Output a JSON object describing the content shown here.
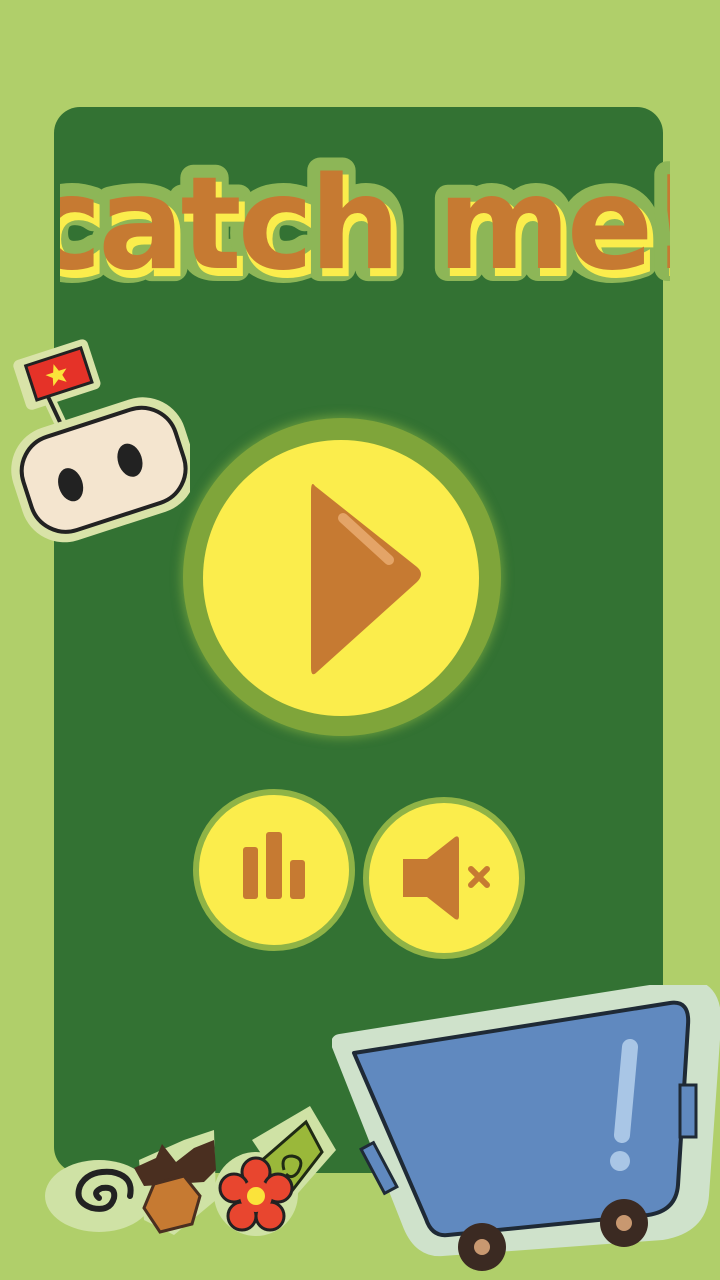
{
  "game": {
    "title": "catch me!",
    "colors": {
      "background": "#b0cf6a",
      "panel": "#337233",
      "button_fill": "#fbed4c",
      "accent_orange": "#c67a32",
      "cart_blue": "#6089bf",
      "flag_red": "#e53228",
      "flag_star": "#fbe33a"
    }
  },
  "menu": {
    "play_icon": "play-triangle-icon",
    "stats_icon": "bar-chart-icon",
    "sound_icon": "speaker-muted-icon",
    "sound_muted": true
  },
  "decorations": {
    "character": "marshmallow-with-flag-icon",
    "cart": "shopping-cart-icon",
    "items": [
      "spiral-icon",
      "acorn-icon",
      "flower-icon",
      "leaf-icon"
    ]
  }
}
